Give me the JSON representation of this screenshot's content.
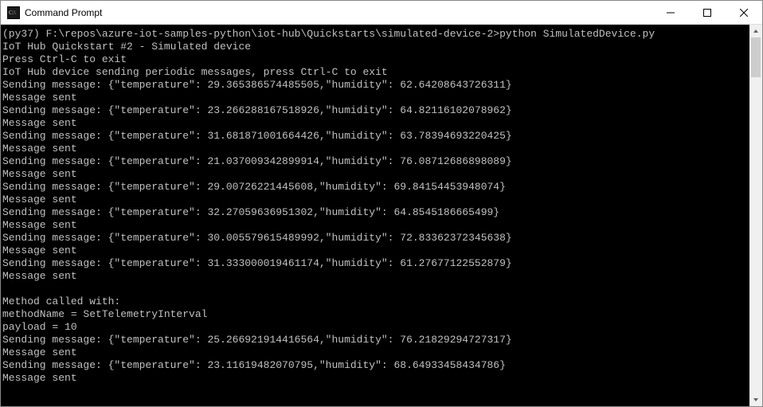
{
  "window": {
    "title": "Command Prompt"
  },
  "terminal": {
    "prompt_line": "(py37) F:\\repos\\azure-iot-samples-python\\iot-hub\\Quickstarts\\simulated-device-2>python SimulatedDevice.py",
    "app_title": "IoT Hub Quickstart #2 - Simulated device",
    "exit_hint": "Press Ctrl-C to exit",
    "device_line": "IoT Hub device sending periodic messages, press Ctrl-C to exit",
    "sent_label": "Message sent",
    "send_prefix": "Sending message: ",
    "messages": [
      "{\"temperature\": 29.365386574485505,\"humidity\": 62.64208643726311}",
      "{\"temperature\": 23.266288167518926,\"humidity\": 64.82116102078962}",
      "{\"temperature\": 31.681871001664426,\"humidity\": 63.78394693220425}",
      "{\"temperature\": 21.037009342899914,\"humidity\": 76.08712686898089}",
      "{\"temperature\": 29.00726221445608,\"humidity\": 69.84154453948074}",
      "{\"temperature\": 32.27059636951302,\"humidity\": 64.8545186665499}",
      "{\"temperature\": 30.005579615489992,\"humidity\": 72.83362372345638}",
      "{\"temperature\": 31.333000019461174,\"humidity\": 61.27677122552879}"
    ],
    "blank": " ",
    "method_header": "Method called with:",
    "method_name_line": "methodName = SetTelemetryInterval",
    "payload_line": "payload = 10",
    "messages_after": [
      "{\"temperature\": 25.266921914416564,\"humidity\": 76.21829294727317}",
      "{\"temperature\": 23.11619482070795,\"humidity\": 68.64933458434786}"
    ]
  }
}
